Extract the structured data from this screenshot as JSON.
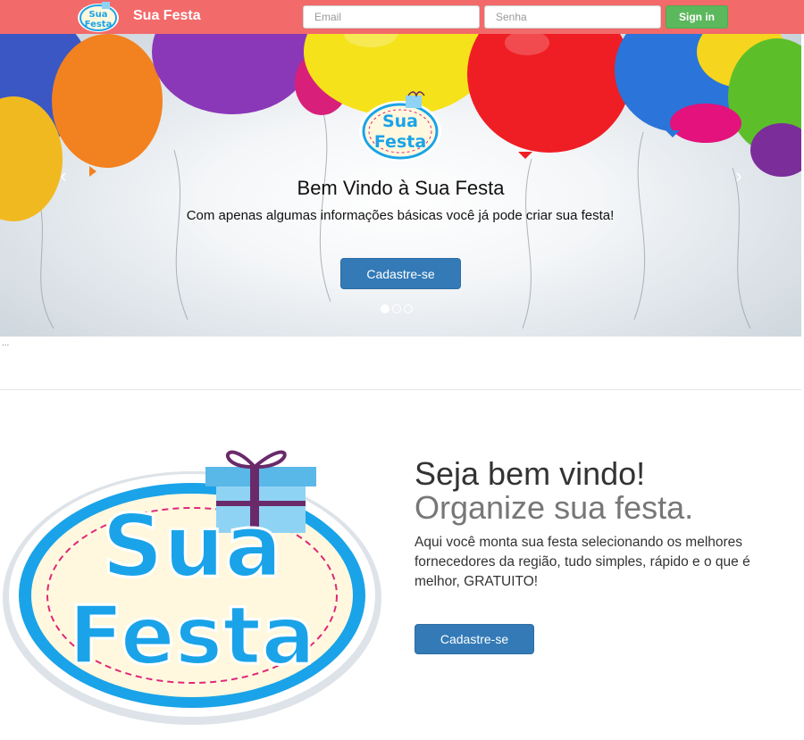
{
  "navbar": {
    "brand": "Sua Festa",
    "logo_text_line1": "Sua",
    "logo_text_line2": "Festa",
    "email_placeholder": "Email",
    "senha_placeholder": "Senha",
    "signin_label": "Sign in"
  },
  "carousel": {
    "logo_text_line1": "Sua",
    "logo_text_line2": "Festa",
    "title": "Bem Vindo à Sua Festa",
    "subtitle": "Com apenas algumas informações básicas você já pode criar sua festa!",
    "button_label": "Cadastre-se",
    "prev_icon": "‹",
    "next_icon": "›",
    "slides": 3,
    "active_slide": 1
  },
  "ellipsis": "...",
  "feature": {
    "logo_text_line1": "Sua",
    "logo_text_line2": "Festa",
    "heading_line1": "Seja bem vindo!",
    "heading_line2": "Organize sua festa.",
    "text": "Aqui você monta sua festa selecionando os melhores fornecedores da região, tudo simples, rápido e o que é melhor, GRATUITO!",
    "button_label": "Cadastre-se"
  },
  "colors": {
    "navbar": "#f26a6a",
    "signin": "#5cb85c",
    "primary": "#337ab7",
    "logo_blue": "#1aa3e8",
    "logo_cream": "#fff8de"
  }
}
